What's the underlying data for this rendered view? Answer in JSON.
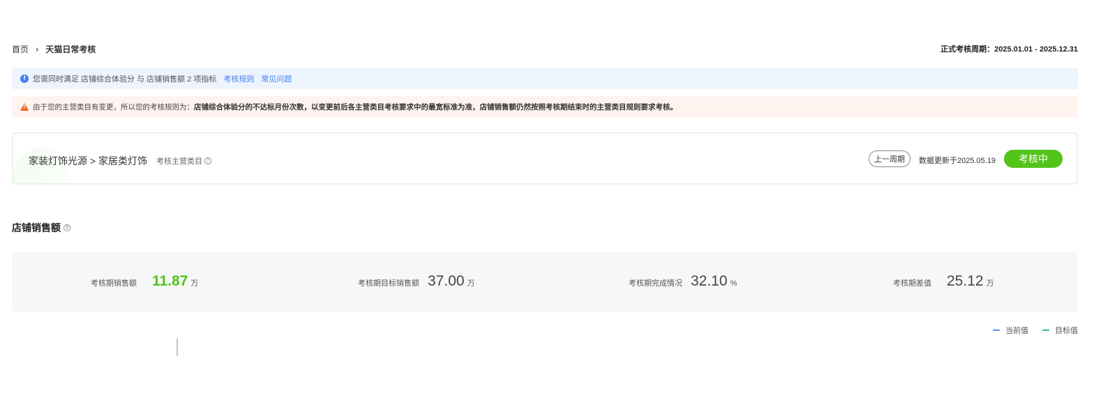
{
  "breadcrumb": {
    "home": "首页",
    "separator": "›",
    "current": "天猫日常考核"
  },
  "period": {
    "text": "正式考核周期：2025.01.01 - 2025.12.31"
  },
  "notice_info": {
    "text": "您需同时满足 店铺综合体验分 与 店铺销售额 2 项指标",
    "link_rules": "考核规则",
    "link_faq": "常见问题"
  },
  "notice_warn": {
    "prefix": "由于您的主营类目有变更，所以您的考核规则为：",
    "rule": "店铺综合体验分的不达标月份次数，以变更前后各主营类目考核要求中的最宽标准为准，店铺销售额仍然按照考核期结束时的主营类目规则要求考核。"
  },
  "category": {
    "path": "家装灯饰光源 > 家居类灯饰",
    "sub_label": "考核主营类目",
    "prev_button": "上一周期",
    "updated": "数据更新于2025.05.19",
    "status": "考核中"
  },
  "section": {
    "title": "店铺销售额"
  },
  "metrics": [
    {
      "label": "考核期销售额",
      "value": "11.87",
      "unit": "万"
    },
    {
      "label": "考核期目标销售额",
      "value": "37.00",
      "unit": "万"
    },
    {
      "label": "考核期完成情况",
      "value": "32.10",
      "unit": "%"
    },
    {
      "label": "考核期差值",
      "value": "25.12",
      "unit": "万"
    }
  ],
  "legend": {
    "current": "当前值",
    "target": "目标值"
  },
  "colors": {
    "accent_green": "#52c41a",
    "info_blue": "#3e7ff5",
    "warn_orange": "#f5621e",
    "current_line": "#5b8ff9",
    "target_line": "#2fc28f"
  }
}
